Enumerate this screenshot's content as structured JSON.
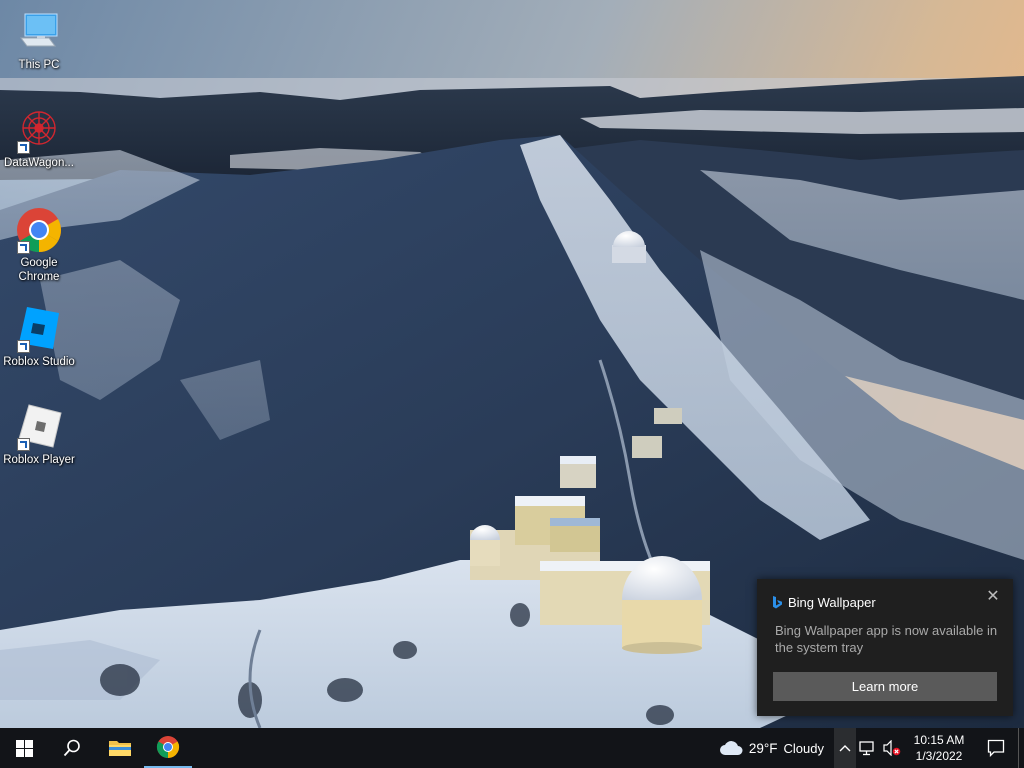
{
  "desktop": {
    "icons": [
      {
        "label": "This PC",
        "icon": "this-pc-icon"
      },
      {
        "label": "DataWagon...",
        "icon": "datawagon-icon"
      },
      {
        "label": "Google Chrome",
        "icon": "chrome-icon"
      },
      {
        "label": "Roblox Studio",
        "icon": "roblox-studio-icon"
      },
      {
        "label": "Roblox Player",
        "icon": "roblox-player-icon"
      }
    ]
  },
  "notification": {
    "app": "Bing Wallpaper",
    "message": "Bing Wallpaper app is now available in the system tray",
    "action_label": "Learn more",
    "close_glyph": "✕"
  },
  "taskbar": {
    "pinned": [
      "start-icon",
      "search-icon",
      "file-explorer-icon",
      "chrome-icon"
    ],
    "weather": {
      "temp": "29°F",
      "condition": "Cloudy"
    },
    "tray_chevron": "^",
    "clock": {
      "time": "10:15 AM",
      "date": "1/3/2022"
    }
  },
  "colors": {
    "taskbar_bg": "#121418",
    "toast_bg": "#1f1f1f",
    "toast_button": "#5a5a5a",
    "accent_blue": "#76b9ed"
  }
}
